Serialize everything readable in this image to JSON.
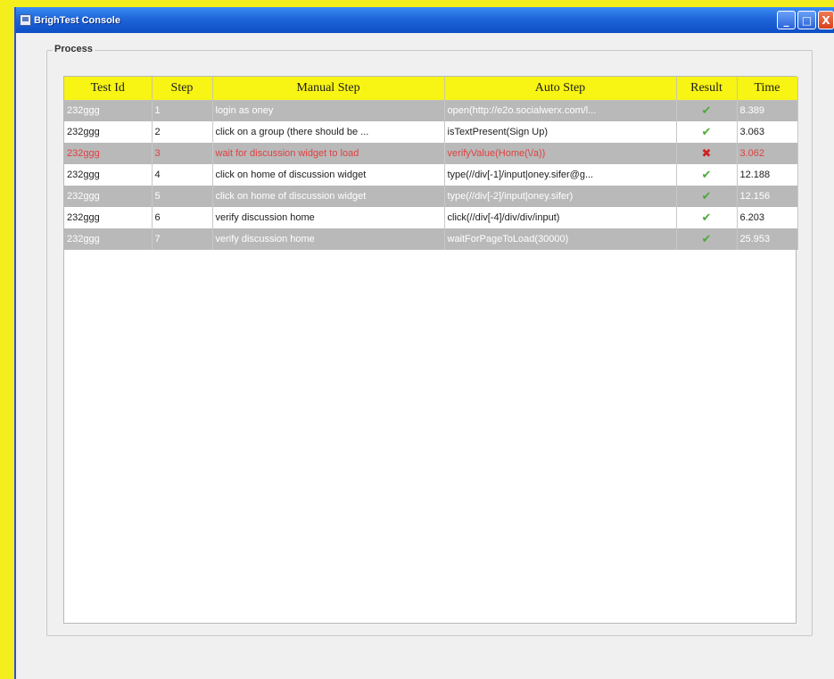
{
  "window": {
    "title": "BrighTest Console"
  },
  "window_buttons": {
    "minimize": "_",
    "maximize": "□",
    "close": "X"
  },
  "group": {
    "label": "Process"
  },
  "table": {
    "headers": [
      "Test Id",
      "Step",
      "Manual Step",
      "Auto Step",
      "Result",
      "Time"
    ],
    "rows": [
      {
        "test_id": "232ggg",
        "step": "1",
        "manual": "login as oney",
        "auto": "open(http://e2o.socialwerx.com/l...",
        "result": "pass",
        "result_glyph": "✔",
        "time": "8.389",
        "style": "grey"
      },
      {
        "test_id": "232ggg",
        "step": "2",
        "manual": "click on a group (there should be ...",
        "auto": "isTextPresent(Sign Up)",
        "result": "pass",
        "result_glyph": "✔",
        "time": "3.063",
        "style": "white"
      },
      {
        "test_id": "232ggg",
        "step": "3",
        "manual": "wait for discussion widget to load",
        "auto": "verifyValue(Home(\\/a))",
        "result": "fail",
        "result_glyph": "✖",
        "time": "3.062",
        "style": "fail"
      },
      {
        "test_id": "232ggg",
        "step": "4",
        "manual": "click on home of discussion widget",
        "auto": "type(//div[-1]/input|oney.sifer@g...",
        "result": "pass",
        "result_glyph": "✔",
        "time": "12.188",
        "style": "white"
      },
      {
        "test_id": "232ggg",
        "step": "5",
        "manual": "click on home of discussion widget",
        "auto": "type(//div[-2]/input|oney.sifer)",
        "result": "pass",
        "result_glyph": "✔",
        "time": "12.156",
        "style": "grey"
      },
      {
        "test_id": "232ggg",
        "step": "6",
        "manual": "verify discussion home",
        "auto": "click(//div[-4]/div/div/input)",
        "result": "pass",
        "result_glyph": "✔",
        "time": "6.203",
        "style": "white"
      },
      {
        "test_id": "232ggg",
        "step": "7",
        "manual": "verify discussion home",
        "auto": "waitForPageToLoad(30000)",
        "result": "pass",
        "result_glyph": "✔",
        "time": "25.953",
        "style": "grey"
      }
    ]
  },
  "colors": {
    "desktop": "#f4ee1c",
    "header": "#f8f413",
    "row_grey": "#b9b9b9",
    "fail_text": "#e04040",
    "pass_icon": "#4fa83a",
    "fail_icon": "#d02020"
  },
  "icons": {
    "app": "app-window-icon",
    "pass": "check-icon",
    "fail": "cross-icon"
  }
}
